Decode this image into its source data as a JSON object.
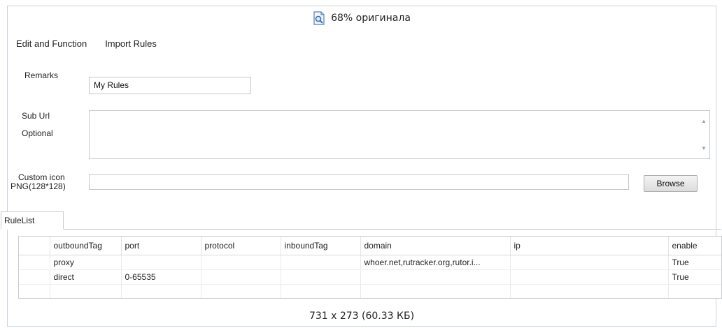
{
  "viewer": {
    "zoom_label": "68% оригинала",
    "footer_label": "731 x 273 (60.33 КБ)"
  },
  "menu": {
    "items": [
      "Edit and Function",
      "Import Rules"
    ]
  },
  "form": {
    "remarks_label": "Remarks",
    "remarks_value": "My Rules",
    "sub_url_label_line1": "Sub Url",
    "sub_url_label_line2": "Optional",
    "sub_url_value": "",
    "custom_icon_label_line1": "Custom icon",
    "custom_icon_label_line2": "PNG(128*128)",
    "custom_icon_value": "",
    "browse_label": "Browse"
  },
  "tabs": {
    "active": "RuleList"
  },
  "rule_table": {
    "columns": [
      "",
      "outboundTag",
      "port",
      "protocol",
      "inboundTag",
      "domain",
      "ip",
      "enable"
    ],
    "rows": [
      [
        "",
        "proxy",
        "",
        "",
        "",
        "whoer.net,rutracker.org,rutor.i...",
        "",
        "True"
      ],
      [
        "",
        "direct",
        "0-65535",
        "",
        "",
        "",
        "",
        "True"
      ]
    ]
  },
  "colors": {
    "frame_border": "#c9d2de",
    "grid_border": "#c9ccd0"
  }
}
